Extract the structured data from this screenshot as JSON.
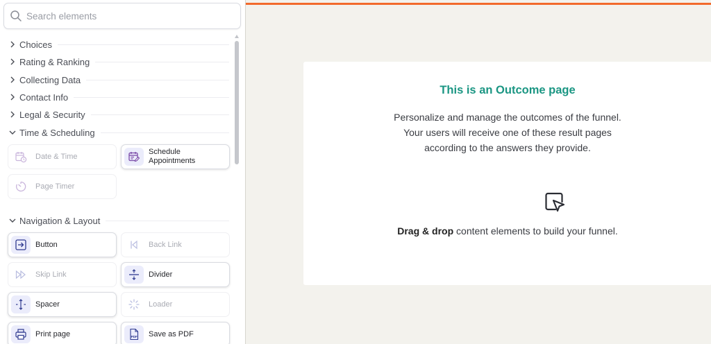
{
  "search": {
    "placeholder": "Search elements"
  },
  "categories": [
    {
      "label": "Choices",
      "expanded": false
    },
    {
      "label": "Rating & Ranking",
      "expanded": false
    },
    {
      "label": "Collecting Data",
      "expanded": false
    },
    {
      "label": "Contact Info",
      "expanded": false
    },
    {
      "label": "Legal & Security",
      "expanded": false
    },
    {
      "label": "Time & Scheduling",
      "expanded": true
    },
    {
      "label": "Navigation & Layout",
      "expanded": true
    }
  ],
  "time_elements": [
    {
      "label": "Date & Time",
      "icon": "calendar-clock-icon",
      "enabled": false
    },
    {
      "label": "Schedule Appointments",
      "icon": "calendar-edit-icon",
      "enabled": true
    },
    {
      "label": "Page Timer",
      "icon": "timer-icon",
      "enabled": false
    }
  ],
  "nav_elements": [
    {
      "label": "Button",
      "icon": "button-arrow-icon",
      "enabled": true
    },
    {
      "label": "Back Link",
      "icon": "back-link-icon",
      "enabled": false
    },
    {
      "label": "Skip Link",
      "icon": "skip-link-icon",
      "enabled": false
    },
    {
      "label": "Divider",
      "icon": "divider-icon",
      "enabled": true
    },
    {
      "label": "Spacer",
      "icon": "spacer-icon",
      "enabled": true
    },
    {
      "label": "Loader",
      "icon": "loader-icon",
      "enabled": false
    },
    {
      "label": "Print page",
      "icon": "printer-icon",
      "enabled": true
    },
    {
      "label": "Save as PDF",
      "icon": "pdf-file-icon",
      "enabled": true
    }
  ],
  "canvas": {
    "title": "This is an Outcome page",
    "description_lines": [
      "Personalize and manage the outcomes of the funnel.",
      "Your users will receive one of these result pages",
      "according to the answers they provide."
    ],
    "dnd_bold": "Drag & drop",
    "dnd_rest": " content elements to build your funnel."
  },
  "colors": {
    "accent_title": "#1b9683",
    "top_bar": "#f26a2c",
    "canvas_bg": "#f3f2ed",
    "icon_bg": "#ebecfb"
  }
}
